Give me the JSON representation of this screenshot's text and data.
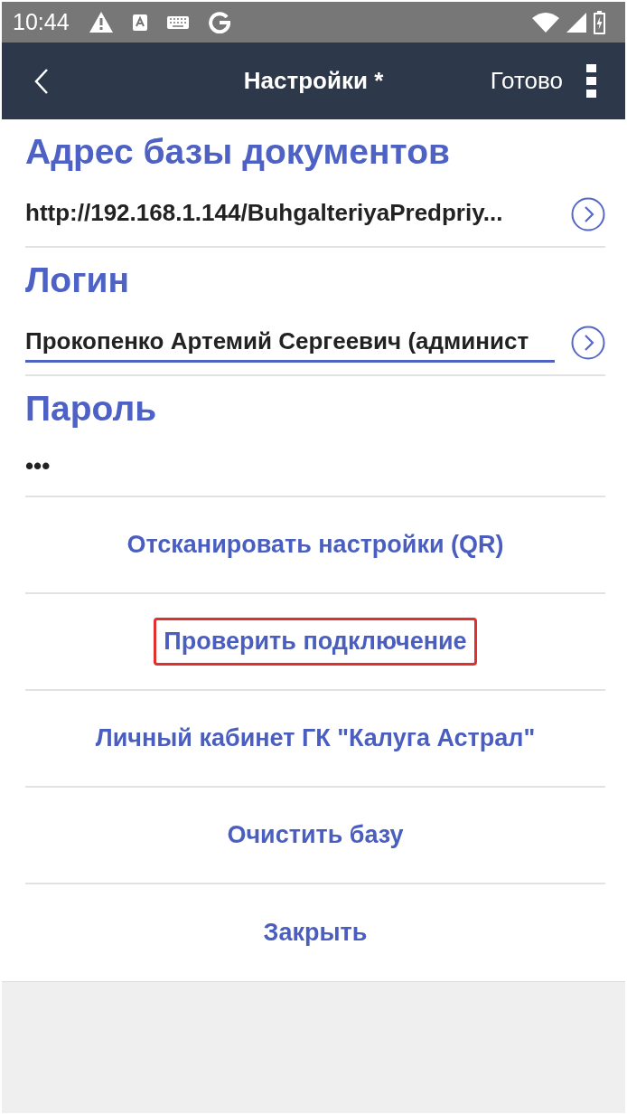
{
  "status_bar": {
    "time": "10:44"
  },
  "nav": {
    "title": "Настройки *",
    "done": "Готово"
  },
  "fields": [
    {
      "kind": "picker",
      "label": "Адрес базы документов",
      "value": "http://192.168.1.144/BuhgalteriyaPredpriy...",
      "focused": false
    },
    {
      "kind": "picker",
      "label": "Логин",
      "value": "Прокопенко Артемий Сергеевич (админист",
      "focused": true
    },
    {
      "kind": "password",
      "label": "Пароль",
      "value": "•••",
      "focused": false
    }
  ],
  "actions": [
    {
      "label": "Отсканировать настройки (QR)",
      "highlighted": false
    },
    {
      "label": "Проверить подключение",
      "highlighted": true
    },
    {
      "label": "Личный кабинет ГК \"Калуга Астрал\"",
      "highlighted": false
    },
    {
      "label": "Очистить базу",
      "highlighted": false
    },
    {
      "label": "Закрыть",
      "highlighted": false
    }
  ]
}
